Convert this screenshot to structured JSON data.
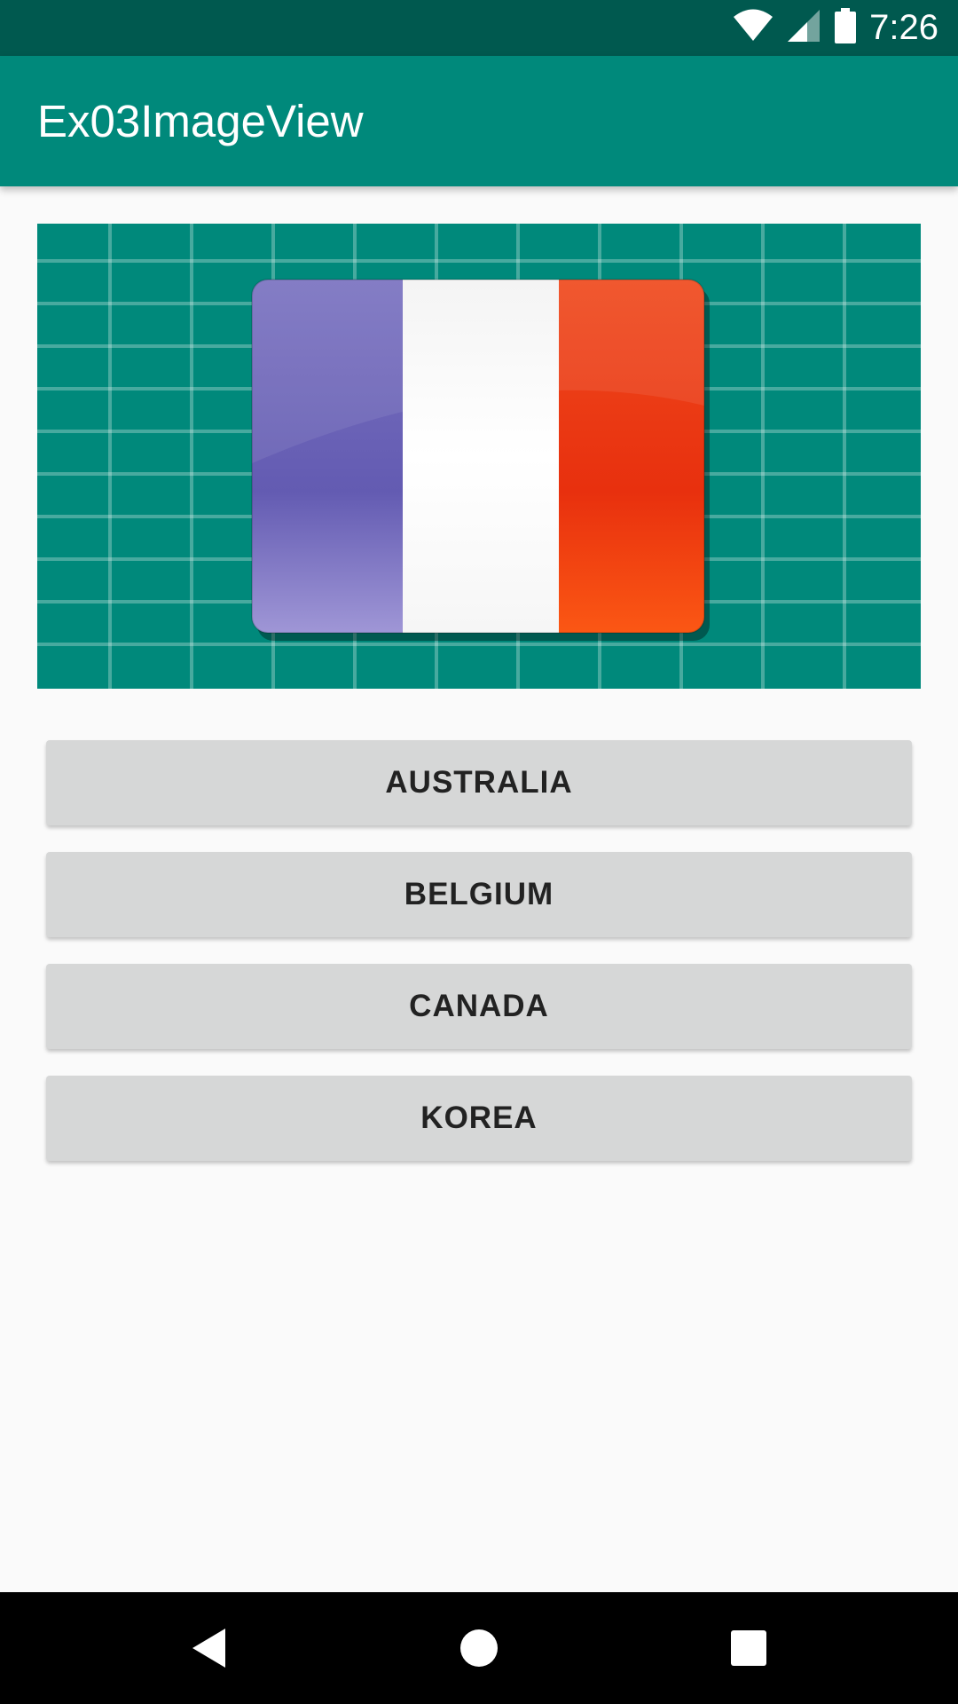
{
  "status_bar": {
    "time": "7:26",
    "icons": [
      "wifi-icon",
      "cell-signal-icon",
      "battery-icon"
    ]
  },
  "app_bar": {
    "title": "Ex03ImageView",
    "color": "#00897b"
  },
  "image_view": {
    "description_icon": "france-flag",
    "flag_colors": [
      "#6c64b8",
      "#ffffff",
      "#e8350f"
    ],
    "background_color": "#00897b"
  },
  "buttons": [
    {
      "label": "AUSTRALIA"
    },
    {
      "label": "BELGIUM"
    },
    {
      "label": "CANADA"
    },
    {
      "label": "KOREA"
    }
  ],
  "nav_bar": {
    "icons": [
      "back-icon",
      "home-icon",
      "recents-icon"
    ]
  }
}
